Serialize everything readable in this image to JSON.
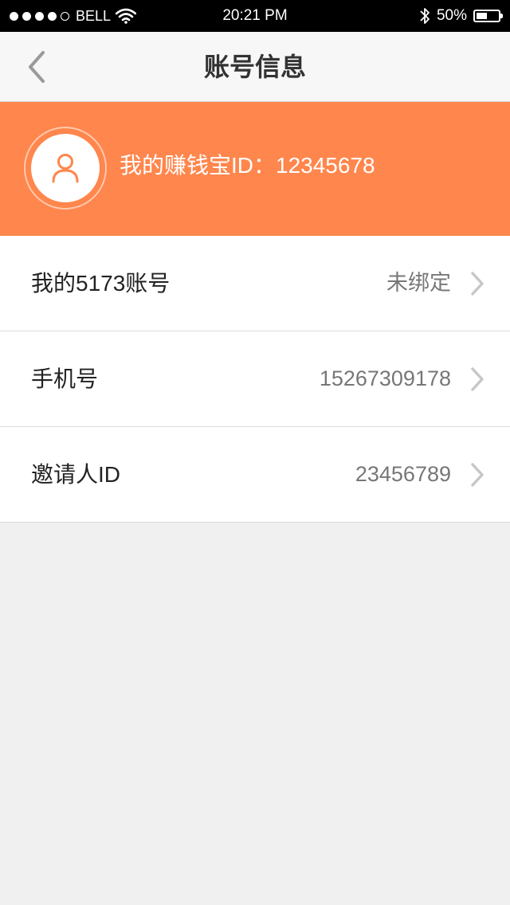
{
  "status_bar": {
    "carrier": "BELL",
    "time": "20:21  PM",
    "battery": "50%",
    "battery_level": 0.5,
    "signal_bars_filled": 4,
    "signal_bars_total": 5
  },
  "nav": {
    "title": "账号信息",
    "back_icon": "chevron-left-icon"
  },
  "profile": {
    "id_text": "我的赚钱宝ID：12345678",
    "avatar_icon": "user-icon"
  },
  "rows": [
    {
      "label": "我的5173账号",
      "value": "未绑定"
    },
    {
      "label": "手机号",
      "value": "15267309178"
    },
    {
      "label": "邀请人ID",
      "value": "23456789"
    }
  ],
  "colors": {
    "accent": "#ff864c",
    "background": "#f0f0f0",
    "chevron": "#c7c7c7"
  }
}
